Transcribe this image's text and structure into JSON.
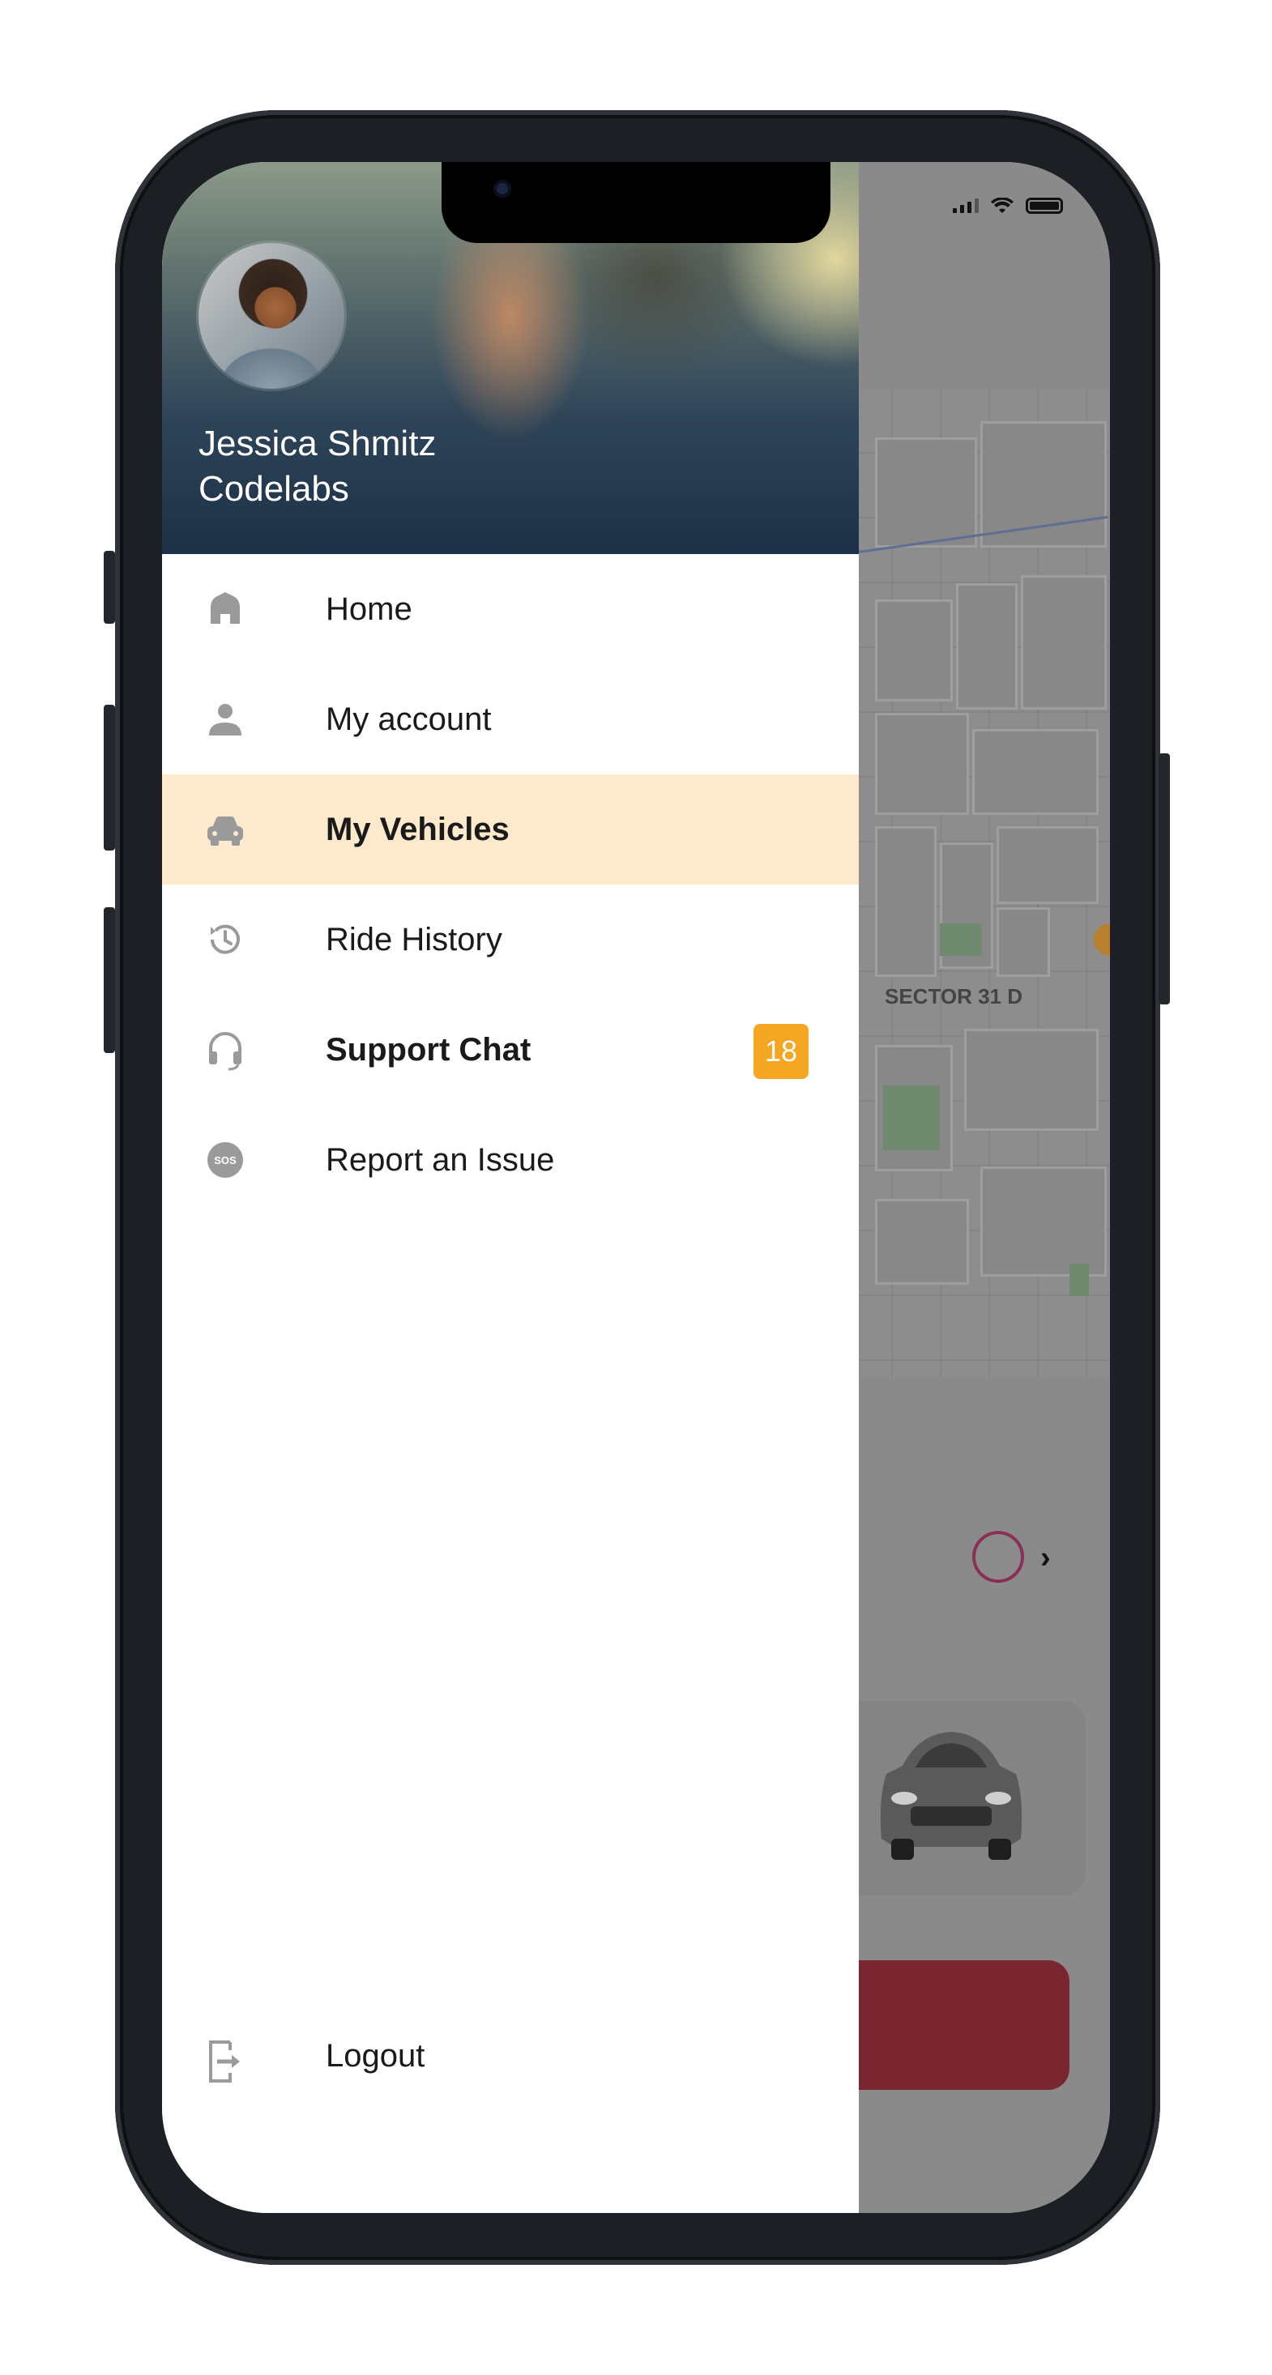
{
  "profile": {
    "name": "Jessica Shmitz",
    "organization": "Codelabs"
  },
  "menu": {
    "items": [
      {
        "label": "Home",
        "icon": "home-icon"
      },
      {
        "label": "My account",
        "icon": "person-icon"
      },
      {
        "label": "My Vehicles",
        "icon": "car-icon",
        "active": true
      },
      {
        "label": "Ride History",
        "icon": "history-icon"
      },
      {
        "label": "Support Chat",
        "icon": "headset-icon",
        "badge": "18"
      },
      {
        "label": "Report an Issue",
        "icon": "sos-icon"
      }
    ],
    "logout": {
      "label": "Logout",
      "icon": "logout-icon"
    }
  },
  "background": {
    "map_label": "SECTOR 31 D"
  },
  "colors": {
    "active_item_bg": "#fde9cc",
    "badge_bg": "#f5a623",
    "icon_gray": "#9a9a9a"
  }
}
